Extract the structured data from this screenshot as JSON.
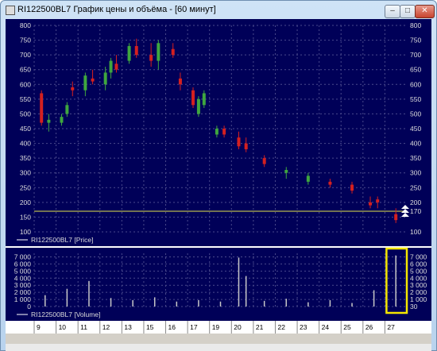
{
  "window": {
    "title": "RI122500BL7 График цены и объёма - [60 минут]",
    "buttons": {
      "minimize": "–",
      "maximize": "□",
      "close": "✕"
    }
  },
  "colors": {
    "background": "#000058",
    "up_candle": "#3fa63f",
    "down_candle": "#d42020",
    "level_line": "#e6e64a",
    "volume_bar": "#c8c8c8",
    "highlight_box": "#f5e600"
  },
  "legend": {
    "price": "RI122500BL7 [Price]",
    "volume": "RI122500BL7 [Volume]"
  },
  "chart_data": [
    {
      "type": "candlestick",
      "series": [
        {
          "name": "RI122500BL7 [Price]"
        }
      ],
      "ylim": [
        100,
        800
      ],
      "yticks": [
        100,
        150,
        200,
        250,
        300,
        350,
        400,
        450,
        500,
        550,
        600,
        650,
        700,
        750,
        800
      ],
      "level_line": 170,
      "current_price_label": "170",
      "x_days": [
        "9",
        "10",
        "11",
        "12",
        "13",
        "15",
        "16",
        "17",
        "19",
        "20",
        "21",
        "22",
        "23",
        "24",
        "25",
        "26",
        "27"
      ],
      "candles": [
        {
          "day": "9",
          "open": 570,
          "high": 580,
          "low": 460,
          "close": 470
        },
        {
          "day": "9",
          "open": 470,
          "high": 500,
          "low": 440,
          "close": 480
        },
        {
          "day": "10",
          "open": 470,
          "high": 500,
          "low": 460,
          "close": 490
        },
        {
          "day": "10",
          "open": 500,
          "high": 540,
          "low": 490,
          "close": 530
        },
        {
          "day": "10",
          "open": 590,
          "high": 610,
          "low": 560,
          "close": 580
        },
        {
          "day": "11",
          "open": 580,
          "high": 640,
          "low": 560,
          "close": 630
        },
        {
          "day": "11",
          "open": 620,
          "high": 650,
          "low": 600,
          "close": 610
        },
        {
          "day": "12",
          "open": 600,
          "high": 660,
          "low": 580,
          "close": 640
        },
        {
          "day": "12",
          "open": 640,
          "high": 690,
          "low": 620,
          "close": 680
        },
        {
          "day": "12",
          "open": 670,
          "high": 700,
          "low": 640,
          "close": 650
        },
        {
          "day": "13",
          "open": 680,
          "high": 740,
          "low": 670,
          "close": 730
        },
        {
          "day": "13",
          "open": 730,
          "high": 755,
          "low": 690,
          "close": 700
        },
        {
          "day": "15",
          "open": 700,
          "high": 740,
          "low": 660,
          "close": 680
        },
        {
          "day": "15",
          "open": 680,
          "high": 750,
          "low": 650,
          "close": 740
        },
        {
          "day": "16",
          "open": 720,
          "high": 740,
          "low": 690,
          "close": 700
        },
        {
          "day": "16",
          "open": 620,
          "high": 640,
          "low": 580,
          "close": 600
        },
        {
          "day": "17",
          "open": 580,
          "high": 590,
          "low": 520,
          "close": 530
        },
        {
          "day": "17",
          "open": 500,
          "high": 560,
          "low": 490,
          "close": 550
        },
        {
          "day": "17",
          "open": 530,
          "high": 580,
          "low": 520,
          "close": 570
        },
        {
          "day": "19",
          "open": 430,
          "high": 460,
          "low": 420,
          "close": 450
        },
        {
          "day": "19",
          "open": 450,
          "high": 460,
          "low": 420,
          "close": 430
        },
        {
          "day": "20",
          "open": 420,
          "high": 440,
          "low": 380,
          "close": 390
        },
        {
          "day": "20",
          "open": 400,
          "high": 420,
          "low": 370,
          "close": 380
        },
        {
          "day": "21",
          "open": 350,
          "high": 360,
          "low": 320,
          "close": 330
        },
        {
          "day": "22",
          "open": 300,
          "high": 320,
          "low": 280,
          "close": 310
        },
        {
          "day": "23",
          "open": 270,
          "high": 300,
          "low": 260,
          "close": 290
        },
        {
          "day": "24",
          "open": 270,
          "high": 280,
          "low": 250,
          "close": 260
        },
        {
          "day": "25",
          "open": 260,
          "high": 270,
          "low": 230,
          "close": 240
        },
        {
          "day": "26",
          "open": 200,
          "high": 220,
          "low": 180,
          "close": 190
        },
        {
          "day": "26",
          "open": 210,
          "high": 220,
          "low": 180,
          "close": 200
        },
        {
          "day": "27",
          "open": 160,
          "high": 180,
          "low": 130,
          "close": 140
        }
      ]
    },
    {
      "type": "bar",
      "series": [
        {
          "name": "RI122500BL7 [Volume]"
        }
      ],
      "ylim": [
        0,
        7500
      ],
      "yticks": [
        0,
        1000,
        2000,
        3000,
        4000,
        5000,
        6000,
        7000
      ],
      "ytick_labels": [
        "0",
        "1 000",
        "2 000",
        "3 000",
        "4 000",
        "5 000",
        "6 000",
        "7 000"
      ],
      "last_value_label": "30",
      "values": [
        {
          "day": "9",
          "v": 1600
        },
        {
          "day": "10",
          "v": 2500
        },
        {
          "day": "11",
          "v": 3600
        },
        {
          "day": "12",
          "v": 1200
        },
        {
          "day": "13",
          "v": 900
        },
        {
          "day": "15",
          "v": 1300
        },
        {
          "day": "16",
          "v": 700
        },
        {
          "day": "17",
          "v": 900
        },
        {
          "day": "19",
          "v": 700
        },
        {
          "day": "20",
          "v": 6900
        },
        {
          "day": "20",
          "v": 4300
        },
        {
          "day": "21",
          "v": 800
        },
        {
          "day": "22",
          "v": 1100
        },
        {
          "day": "23",
          "v": 600
        },
        {
          "day": "24",
          "v": 900
        },
        {
          "day": "25",
          "v": 500
        },
        {
          "day": "26",
          "v": 2300
        },
        {
          "day": "27",
          "v": 7200
        }
      ]
    }
  ]
}
